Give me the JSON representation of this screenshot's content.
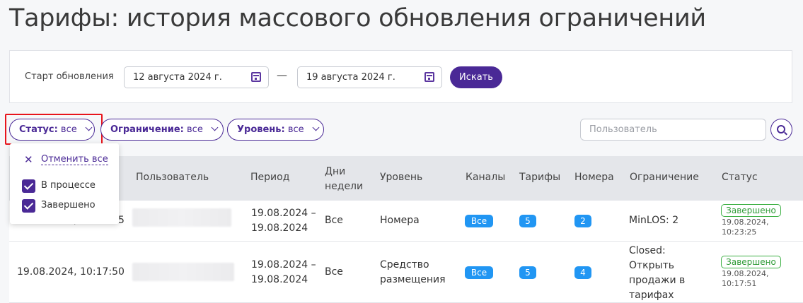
{
  "page": {
    "title": "Тарифы: история массового обновления ограничений"
  },
  "search": {
    "label": "Старт обновления",
    "date_from": "12 августа 2024 г.",
    "separator": "—",
    "date_to": "19 августа 2024 г.",
    "button": "Искать"
  },
  "filters": {
    "status": {
      "label": "Статус:",
      "value": "все"
    },
    "limit": {
      "label": "Ограничение:",
      "value": "все"
    },
    "level": {
      "label": "Уровень:",
      "value": "все"
    },
    "user_placeholder": "Пользователь"
  },
  "status_dropdown": {
    "clear_label": "Отменить все",
    "options": [
      {
        "label": "В процессе",
        "checked": true
      },
      {
        "label": "Завершено",
        "checked": true
      }
    ]
  },
  "table": {
    "columns": [
      "Пользователь",
      "Период",
      "Дни недели",
      "Уровень",
      "Каналы",
      "Тарифы",
      "Номера",
      "Ограничение",
      "Статус"
    ],
    "rows": [
      {
        "start": "19.08.2024, 10:23:25",
        "period_from": "19.08.2024 –",
        "period_to": "19.08.2024",
        "days": "Все",
        "level": "Номера",
        "channels": "Все",
        "tariffs": "5",
        "rooms": "2",
        "limit": "MinLOS: 2",
        "status": "Завершено",
        "status_date": "19.08.2024,",
        "status_time": "10:23:25"
      },
      {
        "start": "19.08.2024, 10:17:50",
        "period_from": "19.08.2024 –",
        "period_to": "19.08.2024",
        "days": "Все",
        "level": "Средство размещения",
        "channels": "Все",
        "tariffs": "5",
        "rooms": "4",
        "limit": "Closed: Открыть продажи в тарифах",
        "status": "Завершено",
        "status_date": "19.08.2024,",
        "status_time": "10:17:51"
      }
    ]
  },
  "colors": {
    "accent": "#4a2996",
    "pill": "#2196f3",
    "success": "#3cb043",
    "highlight": "#e8141c"
  },
  "icons": {
    "calendar": "calendar-icon",
    "search": "search-icon",
    "close": "close-icon",
    "chevron": "chevron-down-icon"
  }
}
